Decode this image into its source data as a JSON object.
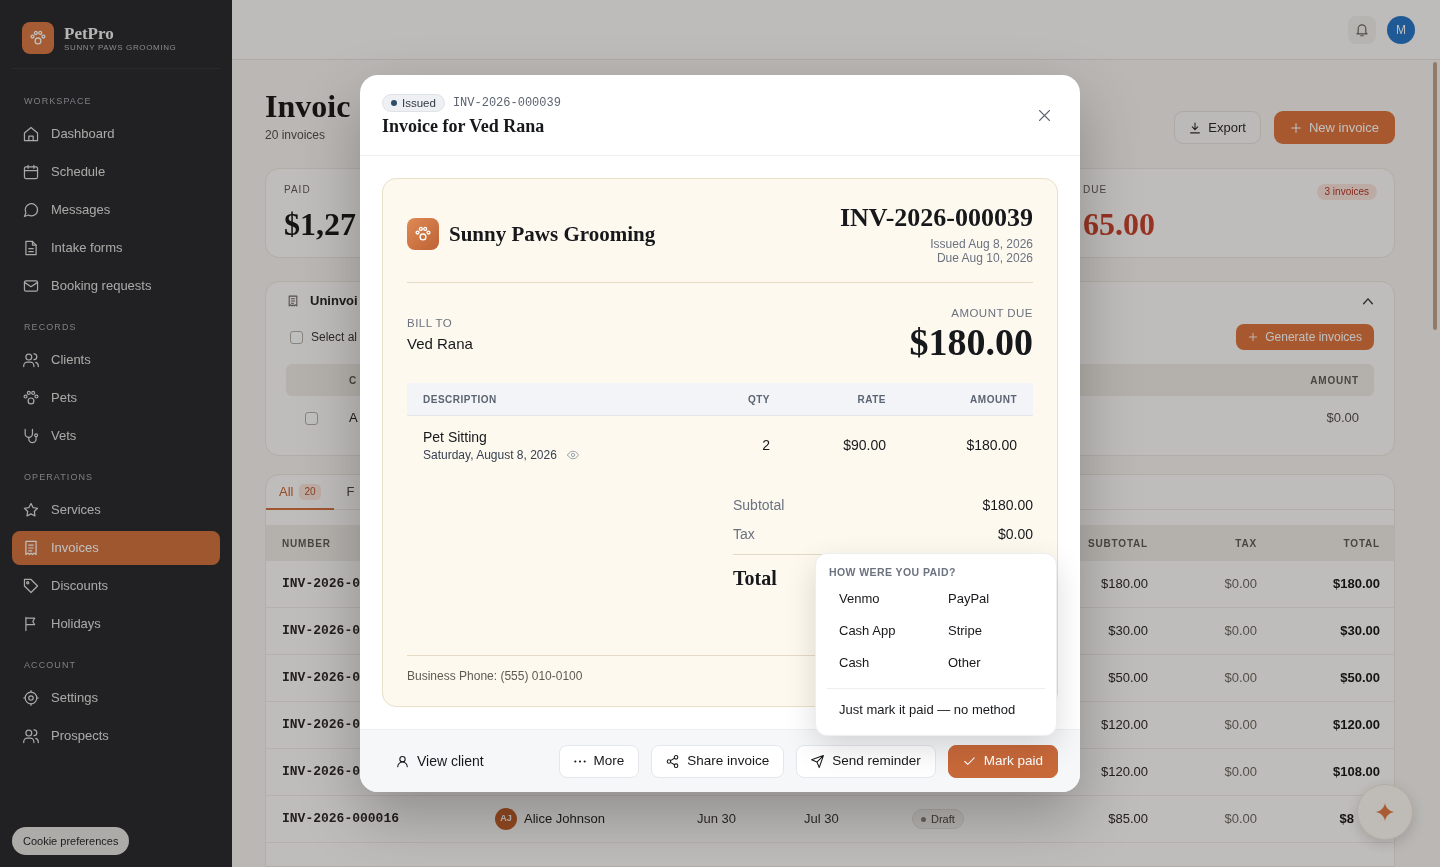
{
  "sidebar": {
    "brand": {
      "name": "PetPro",
      "tagline": "SUNNY PAWS GROOMING"
    },
    "sections": [
      {
        "title": "WORKSPACE",
        "items": [
          {
            "label": "Dashboard",
            "selected": false
          },
          {
            "label": "Schedule",
            "selected": false
          },
          {
            "label": "Messages",
            "selected": false
          },
          {
            "label": "Intake forms",
            "selected": false
          },
          {
            "label": "Booking requests",
            "selected": false
          }
        ]
      },
      {
        "title": "RECORDS",
        "items": [
          {
            "label": "Clients",
            "selected": false
          },
          {
            "label": "Pets",
            "selected": false
          },
          {
            "label": "Vets",
            "selected": false
          }
        ]
      },
      {
        "title": "OPERATIONS",
        "items": [
          {
            "label": "Services",
            "selected": false
          },
          {
            "label": "Invoices",
            "selected": true
          },
          {
            "label": "Discounts",
            "selected": false
          },
          {
            "label": "Holidays",
            "selected": false
          }
        ]
      },
      {
        "title": "ACCOUNT",
        "items": [
          {
            "label": "Settings",
            "selected": false
          },
          {
            "label": "Prospects",
            "selected": false
          }
        ]
      }
    ],
    "cookie_button": "Cookie preferences"
  },
  "top_bar": {
    "avatar_initial": "M"
  },
  "page_header": {
    "title": "Invoic",
    "subtitle": "20 invoices",
    "buttons": [
      {
        "label": "Export",
        "kind": "secondary"
      },
      {
        "label": "New invoice",
        "kind": "primary"
      }
    ]
  },
  "stats": [
    {
      "kind": "paid",
      "label": "PAID",
      "value": "$1,27"
    },
    {
      "kind": "due",
      "label": "DUE",
      "value": "65.00",
      "badge": "3 invoices"
    }
  ],
  "uninvoiced": {
    "title": "Uninvoi",
    "expanded": true,
    "select_all": {
      "label": "Select al",
      "checked": false
    },
    "button": "Generate invoices",
    "columns": [
      "C",
      "AMOUNT"
    ],
    "rows": [
      {
        "checked": false,
        "cells": [
          "A",
          "$0.00"
        ]
      }
    ]
  },
  "invoice_list": {
    "tabs": [
      {
        "label": "All",
        "count": "20",
        "selected": true
      },
      {
        "label": "F",
        "selected": false
      }
    ],
    "columns": [
      "NUMBER",
      "SUBTOTAL",
      "TAX",
      "TOTAL"
    ],
    "rows": [
      {
        "number": "INV-2026-0",
        "subtotal": "$180.00",
        "tax": "$0.00",
        "total": "$180.00"
      },
      {
        "number": "INV-2026-0",
        "subtotal": "$30.00",
        "tax": "$0.00",
        "total": "$30.00"
      },
      {
        "number": "INV-2026-0",
        "subtotal": "$50.00",
        "tax": "$0.00",
        "total": "$50.00"
      },
      {
        "number": "INV-2026-0",
        "subtotal": "$120.00",
        "tax": "$0.00",
        "total": "$120.00"
      },
      {
        "number": "INV-2026-0",
        "subtotal": "$120.00",
        "tax": "$0.00",
        "total": "$108.00"
      },
      {
        "number": "INV-2026-000016",
        "column_2": {
          "initials": "AJ",
          "name": "Alice Johnson"
        },
        "column_3": "Jun 30",
        "column_4": "Jul 30",
        "column_5": "Draft",
        "subtotal": "$85.00",
        "tax": "$0.00",
        "total": "$8"
      }
    ]
  },
  "modal": {
    "status": "Issued",
    "number": "INV-2026-000039",
    "title": "Invoice for Ved Rana",
    "invoice": {
      "business_name": "Sunny Paws Grooming",
      "number": "INV-2026-000039",
      "issued": "Issued Aug 8, 2026",
      "due": "Due Aug 10, 2026",
      "bill_to_label": "BILL TO",
      "bill_to_name": "Ved Rana",
      "amount_due_label": "AMOUNT DUE",
      "amount_due": "$180.00",
      "columns": [
        "DESCRIPTION",
        "QTY",
        "RATE",
        "AMOUNT"
      ],
      "lines": [
        {
          "description": "Pet Sitting",
          "date": "Saturday, August 8, 2026",
          "qty": "2",
          "rate": "$90.00",
          "amount": "$180.00"
        }
      ],
      "totals": [
        {
          "kind": "subtotal",
          "label": "Subtotal",
          "value": "$180.00"
        },
        {
          "kind": "tax",
          "label": "Tax",
          "value": "$0.00"
        },
        {
          "kind": "total",
          "label": "Total"
        }
      ],
      "footer": "Business Phone: (555) 010-0100"
    },
    "payment_menu": {
      "title": "HOW WERE YOU PAID?",
      "methods": [
        "Venmo",
        "PayPal",
        "Cash App",
        "Stripe",
        "Cash",
        "Other"
      ],
      "no_method": "Just mark it paid — no method"
    },
    "footer": {
      "link": "View client",
      "buttons": [
        {
          "label": "More",
          "kind": "secondary"
        },
        {
          "label": "Share invoice",
          "kind": "secondary"
        },
        {
          "label": "Send reminder",
          "kind": "secondary"
        },
        {
          "label": "Mark paid",
          "kind": "primary"
        }
      ]
    }
  }
}
